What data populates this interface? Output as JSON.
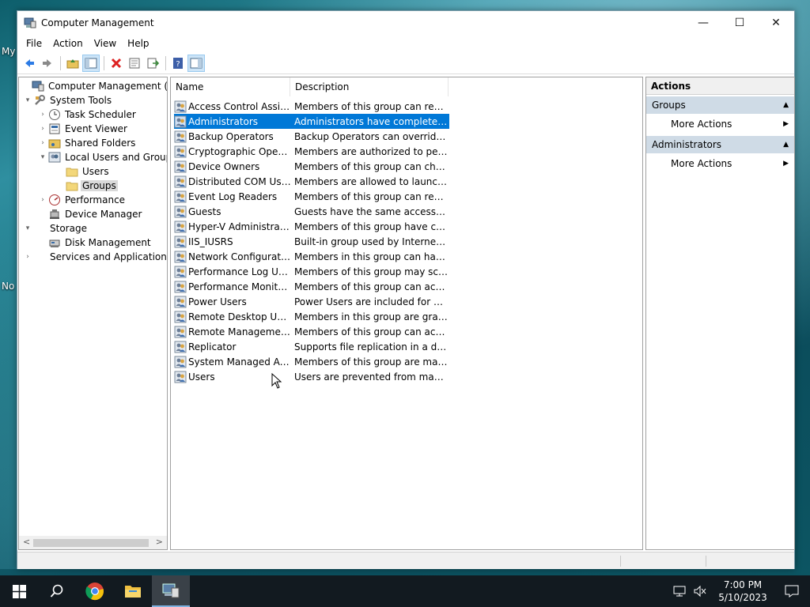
{
  "desktop": {
    "labels": [
      "My",
      "No"
    ]
  },
  "window": {
    "title": "Computer Management",
    "buttons": {
      "minimize": "—",
      "maximize": "☐",
      "close": "✕"
    }
  },
  "menu": [
    "File",
    "Action",
    "View",
    "Help"
  ],
  "tree": [
    {
      "label": "Computer Management (Local",
      "level": 0,
      "expander": "",
      "icon": "computer-management-icon"
    },
    {
      "label": "System Tools",
      "level": 0,
      "expander": "▾",
      "icon": "tools-icon"
    },
    {
      "label": "Task Scheduler",
      "level": 1,
      "expander": "›",
      "icon": "clock-icon"
    },
    {
      "label": "Event Viewer",
      "level": 1,
      "expander": "›",
      "icon": "event-viewer-icon"
    },
    {
      "label": "Shared Folders",
      "level": 1,
      "expander": "›",
      "icon": "shared-folder-icon"
    },
    {
      "label": "Local Users and Groups",
      "level": 1,
      "expander": "▾",
      "icon": "users-groups-icon"
    },
    {
      "label": "Users",
      "level": 2,
      "expander": "",
      "icon": "folder-icon"
    },
    {
      "label": "Groups",
      "level": 2,
      "expander": "",
      "icon": "folder-icon",
      "selected": true
    },
    {
      "label": "Performance",
      "level": 1,
      "expander": "›",
      "icon": "performance-icon"
    },
    {
      "label": "Device Manager",
      "level": 1,
      "expander": "",
      "icon": "device-manager-icon"
    },
    {
      "label": "Storage",
      "level": 0,
      "expander": "▾",
      "icon": "storage-icon"
    },
    {
      "label": "Disk Management",
      "level": 1,
      "expander": "",
      "icon": "disk-icon"
    },
    {
      "label": "Services and Applications",
      "level": 0,
      "expander": "›",
      "icon": "services-icon"
    }
  ],
  "list": {
    "columns": [
      "Name",
      "Description"
    ],
    "rows": [
      {
        "name": "Access Control Assist...",
        "desc": "Members of this group can remot..."
      },
      {
        "name": "Administrators",
        "desc": "Administrators have complete an...",
        "selected": true
      },
      {
        "name": "Backup Operators",
        "desc": "Backup Operators can override se..."
      },
      {
        "name": "Cryptographic Operat...",
        "desc": "Members are authorized to perfor..."
      },
      {
        "name": "Device Owners",
        "desc": "Members of this group can chang..."
      },
      {
        "name": "Distributed COM Users",
        "desc": "Members are allowed to launch, a..."
      },
      {
        "name": "Event Log Readers",
        "desc": "Members of this group can read e..."
      },
      {
        "name": "Guests",
        "desc": "Guests have the same access as m..."
      },
      {
        "name": "Hyper-V Administrators",
        "desc": "Members of this group have com..."
      },
      {
        "name": "IIS_IUSRS",
        "desc": "Built-in group used by Internet Inf..."
      },
      {
        "name": "Network Configuratio...",
        "desc": "Members in this group can have s..."
      },
      {
        "name": "Performance Log Users",
        "desc": "Members of this group may sche..."
      },
      {
        "name": "Performance Monitor ...",
        "desc": "Members of this group can acces..."
      },
      {
        "name": "Power Users",
        "desc": "Power Users are included for back..."
      },
      {
        "name": "Remote Desktop Users",
        "desc": "Members in this group are grante..."
      },
      {
        "name": "Remote Management...",
        "desc": "Members of this group can acces..."
      },
      {
        "name": "Replicator",
        "desc": "Supports file replication in a dom..."
      },
      {
        "name": "System Managed Acc...",
        "desc": "Members of this group are mana..."
      },
      {
        "name": "Users",
        "desc": "Users are prevented from making ..."
      }
    ]
  },
  "actions": {
    "title": "Actions",
    "sections": [
      {
        "label": "Groups",
        "item": "More Actions"
      },
      {
        "label": "Administrators",
        "item": "More Actions"
      }
    ]
  },
  "taskbar": {
    "time": "7:00 PM",
    "date": "5/10/2023"
  }
}
